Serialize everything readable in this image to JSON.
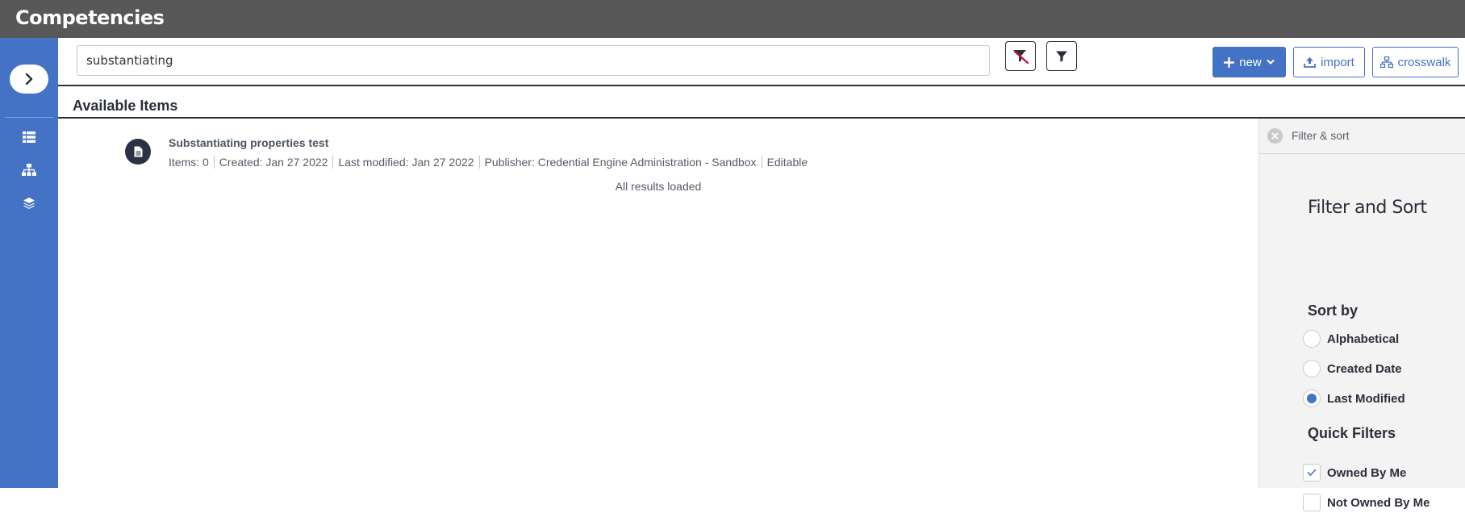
{
  "app": {
    "title": "Competencies"
  },
  "search": {
    "value": "substantiating",
    "placeholder": ""
  },
  "toolbar": {
    "new_label": "new",
    "import_label": "import",
    "crosswalk_label": "crosswalk"
  },
  "section": {
    "title": "Available Items"
  },
  "results": {
    "items": [
      {
        "title": "Substantiating properties test",
        "meta": [
          "Items: 0",
          "Created: Jan 27 2022",
          "Last modified: Jan 27 2022",
          "Publisher: Credential Engine Administration - Sandbox",
          "Editable"
        ]
      }
    ],
    "status": "All results loaded"
  },
  "filter_panel": {
    "header_label": "Filter & sort",
    "title": "Filter and Sort",
    "sort_title": "Sort by",
    "sort_options": [
      {
        "label": "Alphabetical",
        "selected": false
      },
      {
        "label": "Created Date",
        "selected": false
      },
      {
        "label": "Last Modified",
        "selected": true
      }
    ],
    "quick_filters_title": "Quick Filters",
    "quick_filters": [
      {
        "label": "Owned By Me",
        "checked": true
      },
      {
        "label": "Not Owned By Me",
        "checked": false
      }
    ]
  },
  "colors": {
    "accent": "#4472c4",
    "topbar": "#585858",
    "dark": "#2a2f3a",
    "filter_clear_accent": "#c0163a"
  },
  "icons": {
    "sidebar_toggle": "chevron-right-icon",
    "sidebar": [
      "list-icon",
      "hierarchy-icon",
      "layers-icon"
    ],
    "toolbar": [
      "filter-clear-icon",
      "filter-icon",
      "plus-icon",
      "chevron-down-icon",
      "upload-icon",
      "crosswalk-icon"
    ],
    "item": "document-icon"
  }
}
